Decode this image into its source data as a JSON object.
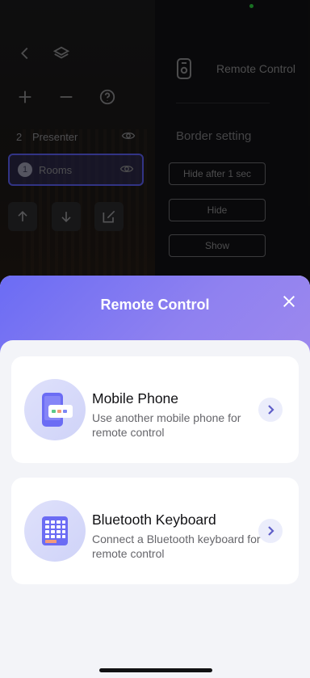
{
  "background_app": {
    "layers": [
      {
        "index": "2",
        "label": "Presenter"
      },
      {
        "index": "1",
        "label": "Rooms"
      }
    ],
    "panel_title": "Remote Control",
    "border_setting_label": "Border setting",
    "options": [
      "Hide after 1 sec",
      "Hide",
      "Show"
    ]
  },
  "sheet": {
    "title": "Remote Control",
    "options": [
      {
        "title": "Mobile Phone",
        "description": "Use another mobile phone for remote control",
        "icon": "mobile-phone-icon"
      },
      {
        "title": "Bluetooth Keyboard",
        "description": "Connect a Bluetooth keyboard for remote control",
        "icon": "keyboard-icon"
      }
    ]
  },
  "colors": {
    "accent": "#6b6cf4",
    "sheet_background": "#f3f4f8",
    "card_background": "#ffffff"
  }
}
